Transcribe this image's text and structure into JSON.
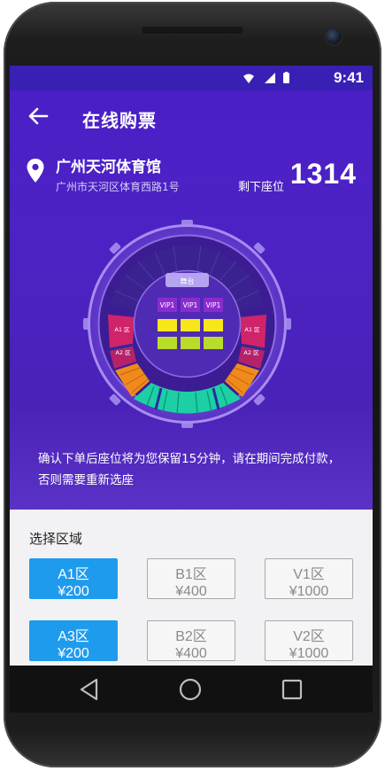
{
  "status": {
    "time": "9:41"
  },
  "header": {
    "title": "在线购票"
  },
  "venue": {
    "name": "广州天河体育馆",
    "address": "广州市天河区体育西路1号",
    "remaining_label": "剩下座位",
    "remaining_count": "1314"
  },
  "seatmap": {
    "stage": "舞台",
    "vip_labels": [
      "VIP1",
      "VIP1",
      "VIP1"
    ],
    "side_labels": [
      "A1 区",
      "A2 区",
      "A1 区",
      "A2 区"
    ]
  },
  "notice": "确认下单后座位将为您保留15分钟，请在期间完成付款，否则需要重新选座",
  "region": {
    "title": "选择区域",
    "zones": [
      {
        "name": "A1区",
        "price": "¥200"
      },
      {
        "name": "B1区",
        "price": "¥400"
      },
      {
        "name": "V1区",
        "price": "¥1000"
      },
      {
        "name": "A3区",
        "price": "¥200"
      },
      {
        "name": "B2区",
        "price": "¥400"
      },
      {
        "name": "V2区",
        "price": "¥1000"
      }
    ]
  },
  "colors": {
    "brand": "#4a1fc6",
    "accent": "#1f9bee"
  },
  "icons": {
    "back": "arrow-left-icon",
    "pin": "location-pin-icon",
    "nav_back": "triangle-back-icon",
    "nav_home": "circle-home-icon",
    "nav_recent": "square-recent-icon"
  }
}
